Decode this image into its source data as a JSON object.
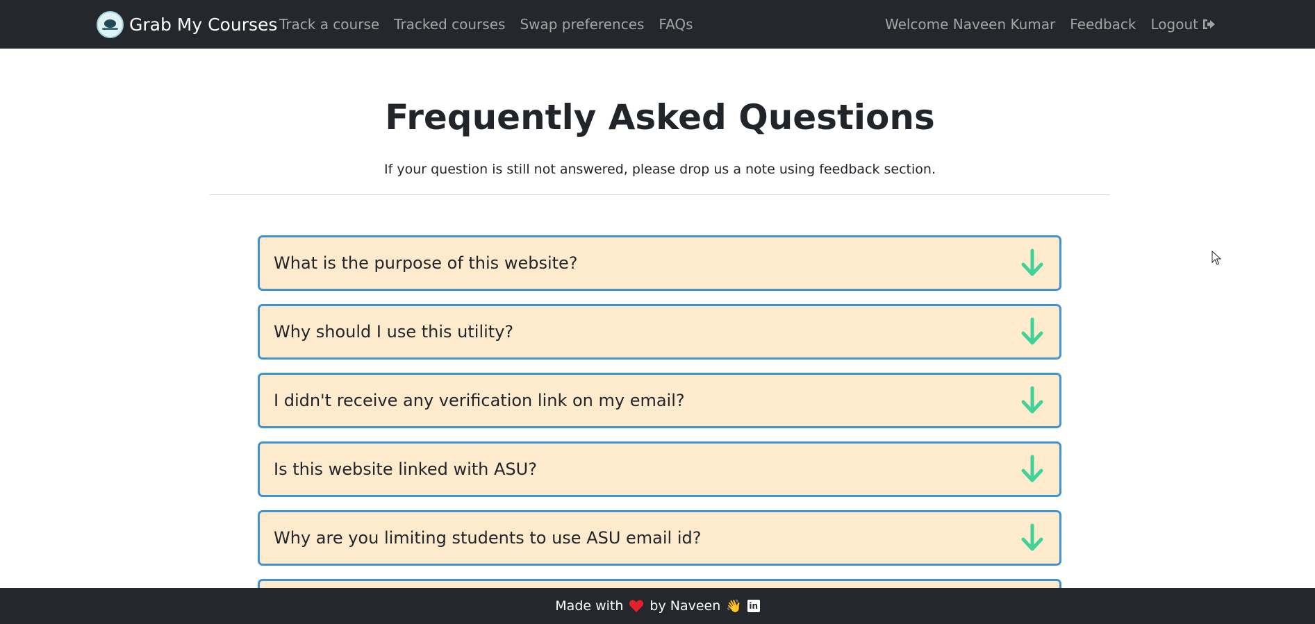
{
  "navbar": {
    "brand": "Grab My Courses",
    "links": [
      {
        "label": "Track a course"
      },
      {
        "label": "Tracked courses"
      },
      {
        "label": "Swap preferences"
      },
      {
        "label": "FAQs"
      }
    ],
    "welcome": "Welcome Naveen Kumar",
    "feedback": "Feedback",
    "logout": "Logout"
  },
  "header": {
    "title": "Frequently Asked Questions",
    "subtitle": "If your question is still not answered, please drop us a note using feedback section."
  },
  "faqs": [
    {
      "question": "What is the purpose of this website?"
    },
    {
      "question": "Why should I use this utility?"
    },
    {
      "question": "I didn't receive any verification link on my email?"
    },
    {
      "question": "Is this website linked with ASU?"
    },
    {
      "question": "Why are you limiting students to use ASU email id?"
    }
  ],
  "footer": {
    "made_with": "Made with",
    "by": "by Naveen"
  },
  "colors": {
    "navbar_bg": "#24272b",
    "faq_bg": "#feebcd",
    "faq_border": "#3f93d0",
    "arrow": "#3fd39a",
    "heart": "#e3202b"
  },
  "icons": [
    "logo-icon",
    "logout-icon",
    "arrow-down-icon",
    "heart-icon",
    "waving-hand-icon",
    "linkedin-icon",
    "mouse-cursor-icon"
  ]
}
